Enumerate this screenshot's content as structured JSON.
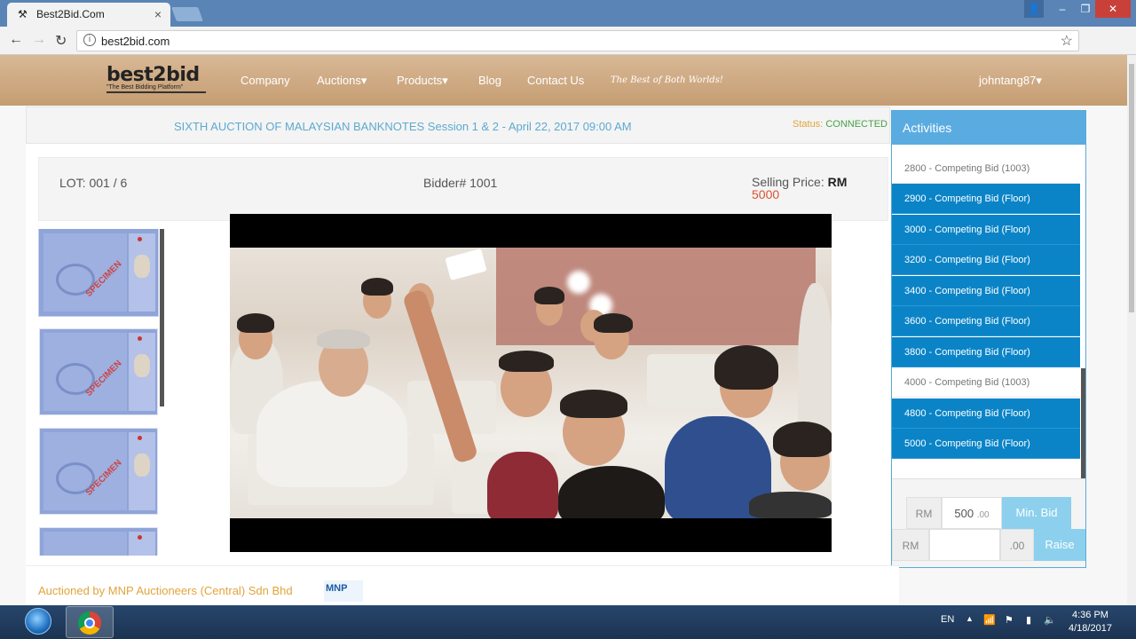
{
  "browser": {
    "tab_title": "Best2Bid.Com",
    "url": "best2bid.com",
    "close_tab": "×"
  },
  "nav": {
    "logo_text": "best2bid",
    "logo_tagline": "\"The Best Bidding Platform\"",
    "items": [
      "Company",
      "Auctions▾",
      "Products▾",
      "Blog",
      "Contact Us"
    ],
    "tagline": "The Best of Both Worlds!",
    "user": "johntang87▾"
  },
  "auction": {
    "title": "SIXTH AUCTION OF MALAYSIAN BANKNOTES Session 1 & 2 - April 22, 2017 09:00 AM",
    "status_label": "Status:",
    "status_value": "CONNECTED",
    "status_color": "#46a046",
    "lot": "LOT: 001 / 6",
    "bidder": "Bidder# 1001",
    "selling_price_label": "Selling Price:",
    "selling_price_currency": "RM",
    "selling_price_value": "5000",
    "price_color": "#d9532c"
  },
  "thumbnails": {
    "spec_label": "SPECIMEN"
  },
  "activities": {
    "header": "Activities",
    "items": [
      {
        "text": "2800 - Competing Bid (1003)",
        "type": "other"
      },
      {
        "text": "2900 - Competing Bid (Floor)",
        "type": "floor"
      },
      {
        "text": "3000 - Competing Bid (Floor)",
        "type": "floor"
      },
      {
        "text": "3200 - Competing Bid (Floor)",
        "type": "floor"
      },
      {
        "text": "3400 - Competing Bid (Floor)",
        "type": "floor"
      },
      {
        "text": "3600 - Competing Bid (Floor)",
        "type": "floor"
      },
      {
        "text": "3800 - Competing Bid (Floor)",
        "type": "floor"
      },
      {
        "text": "4000 - Competing Bid (1003)",
        "type": "other"
      },
      {
        "text": "4800 - Competing Bid (Floor)",
        "type": "floor"
      },
      {
        "text": "5000 - Competing Bid (Floor)",
        "type": "floor"
      }
    ]
  },
  "bid": {
    "currency": "RM",
    "min_amount": "500",
    "cents": ".00",
    "min_bid_label": "Min. Bid",
    "raise_currency": "RM",
    "raise_value": "",
    "raise_cents": ".00",
    "raise_label": "Raise"
  },
  "footer": {
    "auctioned_by": "Auctioned by MNP Auctioneers (Central) Sdn Bhd",
    "mnp_logo": "MNP"
  },
  "taskbar": {
    "lang": "EN",
    "time": "4:36 PM",
    "date": "4/18/2017"
  }
}
